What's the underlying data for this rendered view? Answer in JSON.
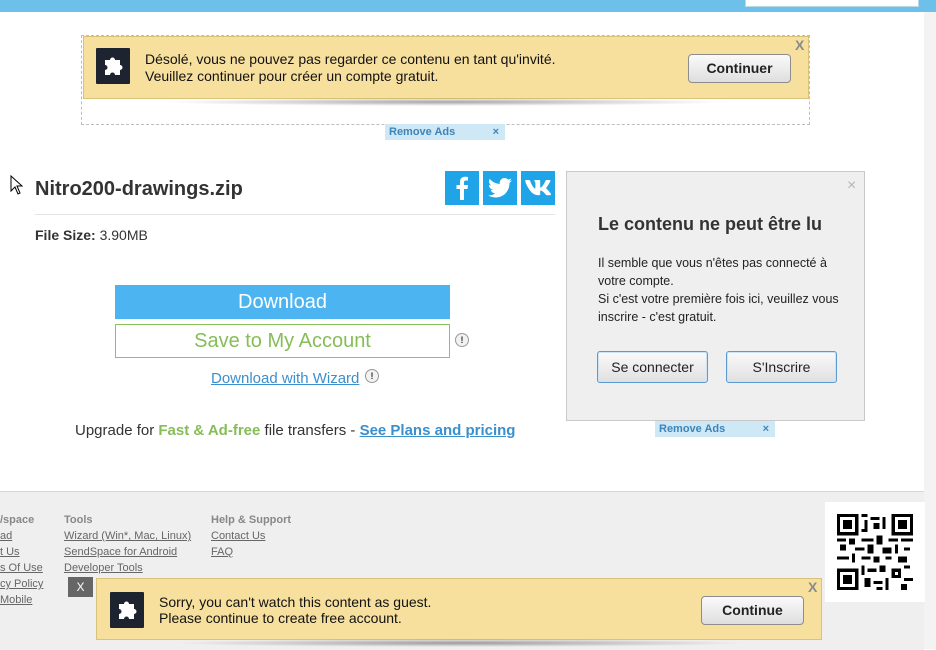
{
  "ad_top": {
    "line1": "Désolé, vous ne pouvez pas regarder ce contenu en tant qu'invité.",
    "line2": "Veuillez continuer pour créer un compte gratuit.",
    "button": "Continuer",
    "close": "X"
  },
  "remove_ads": {
    "label": "Remove Ads",
    "close": "×"
  },
  "file": {
    "name": "Nitro200-drawings.zip",
    "size_label": "File Size:",
    "size_value": "3.90MB"
  },
  "social": {
    "icons": [
      "facebook-icon",
      "twitter-icon",
      "vk-icon"
    ],
    "color": "#1ea4e7"
  },
  "actions": {
    "download": "Download",
    "save": "Save to My Account",
    "wizard": "Download with Wizard"
  },
  "upgrade": {
    "prefix": "Upgrade for ",
    "highlight": "Fast & Ad-free",
    "middle": " file transfers - ",
    "link": "See Plans and pricing"
  },
  "panel": {
    "title": "Le contenu ne peut être lu",
    "text1": "Il semble que vous n'êtes pas connecté à votre compte.",
    "text2": "Si c'est votre première fois ici, veuillez vous inscrire - c'est gratuit.",
    "login": "Se connecter",
    "signup": "S'Inscrire",
    "close": "×"
  },
  "footer": {
    "col1": {
      "head": "/space",
      "links": [
        "ad",
        "t Us",
        "s Of Use",
        "cy Policy",
        "Mobile"
      ]
    },
    "col2": {
      "head": "Tools",
      "links": [
        "Wizard (Win*, Mac, Linux)",
        "SendSpace for Android",
        "Developer Tools"
      ]
    },
    "col3": {
      "head": "Help & Support",
      "links": [
        "Contact Us",
        "FAQ"
      ]
    },
    "close": "X"
  },
  "ad_bottom": {
    "line1": "Sorry, you can't watch this content as guest.",
    "line2": "Please continue to create free account.",
    "button": "Continue",
    "close": "X"
  },
  "colors": {
    "accent_blue": "#4db4f2",
    "green": "#86bd58",
    "ad_yellow": "#f7e09e"
  }
}
